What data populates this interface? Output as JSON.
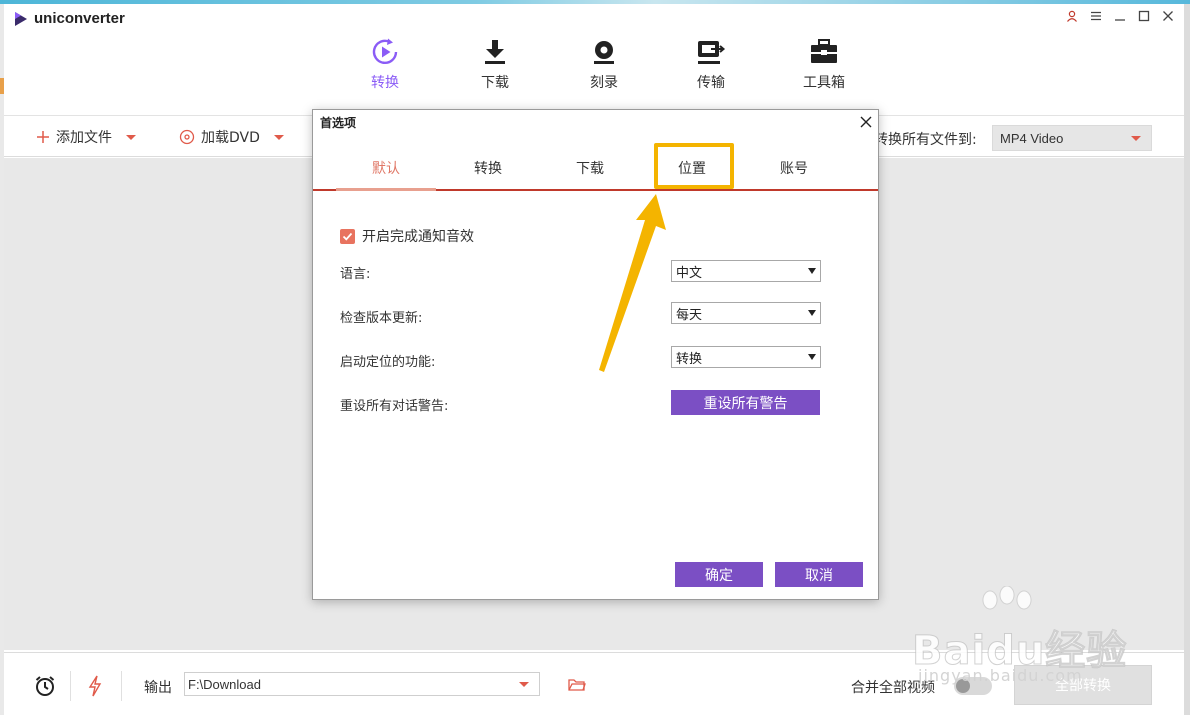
{
  "app": {
    "title": "uniconverter"
  },
  "nav": [
    {
      "id": "convert",
      "label": "转换",
      "icon": "play-circle-icon",
      "active": true
    },
    {
      "id": "download",
      "label": "下载",
      "icon": "download-icon",
      "active": false
    },
    {
      "id": "burn",
      "label": "刻录",
      "icon": "disc-icon",
      "active": false
    },
    {
      "id": "transfer",
      "label": "传输",
      "icon": "transfer-icon",
      "active": false
    },
    {
      "id": "toolbox",
      "label": "工具箱",
      "icon": "toolbox-icon",
      "active": false
    }
  ],
  "toolbar": {
    "add_files": "添加文件",
    "load_dvd": "加载DVD",
    "convert_all_to": "转换所有文件到:",
    "format": "MP4 Video"
  },
  "dialog": {
    "title": "首选项",
    "tabs": [
      "默认",
      "转换",
      "下载",
      "位置",
      "账号"
    ],
    "active_tab": "默认",
    "highlighted_tab": "位置",
    "notify_sound": {
      "label": "开启完成通知音效",
      "checked": true
    },
    "language": {
      "label": "语言:",
      "value": "中文"
    },
    "check_update": {
      "label": "检查版本更新:",
      "value": "每天"
    },
    "startup_function": {
      "label": "启动定位的功能:",
      "value": "转换"
    },
    "reset_warnings": {
      "label": "重设所有对话警告:",
      "button": "重设所有警告"
    },
    "ok": "确定",
    "cancel": "取消"
  },
  "footer": {
    "output_label": "输出",
    "output_path": "F:\\Download",
    "merge_label": "合并全部视频",
    "merge_enabled": false,
    "convert_all": "全部转换"
  },
  "watermark": {
    "text": "Baidu经验",
    "url": "jingyan.baidu.com"
  },
  "colors": {
    "accent": "#7b4fc4",
    "active_nav": "#8b5cf6",
    "active_tab": "#e07766",
    "checkbox": "#e8735f",
    "highlight": "#f4b400",
    "caret": "#e05a4a"
  }
}
